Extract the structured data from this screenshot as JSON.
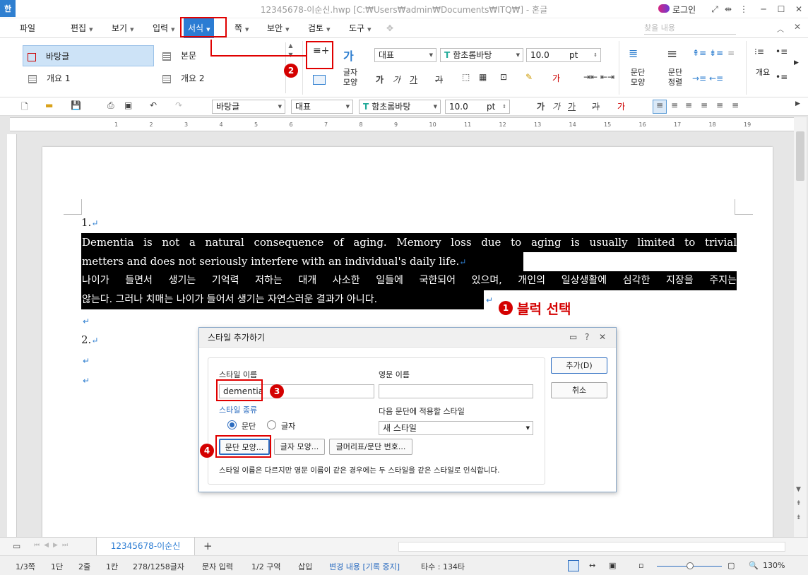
{
  "window": {
    "app_icon": "한",
    "title": "12345678-이순신.hwp [C:₩Users₩admin₩Documents₩ITQ₩] - 혼글",
    "login": "로그인"
  },
  "menu": {
    "file": "파일",
    "items": [
      "편집",
      "보기",
      "입력",
      "서식",
      "쪽",
      "보안",
      "검토",
      "도구"
    ],
    "search_placeholder": "찾을 내용"
  },
  "ribbon": {
    "style_list": [
      "바탕글",
      "본문",
      "개요 1",
      "개요 2"
    ],
    "style_combo": "대표",
    "font_combo": "함초롬바탕",
    "size_combo": "10.0",
    "size_unit": "pt",
    "char_shape_label": "글자\n모양",
    "para_shape_label": "문단\n모양",
    "para_align_label": "문단\n정렬",
    "outline_label": "개요"
  },
  "toolbar": {
    "style_combo": "바탕글",
    "lang_combo": "대표",
    "font_combo": "함초롬바탕",
    "size_combo": "10.0",
    "size_unit": "pt"
  },
  "ruler": {
    "ticks": [
      "1",
      "2",
      "3",
      "4",
      "5",
      "6",
      "7",
      "8",
      "9",
      "10",
      "11",
      "12",
      "13",
      "14",
      "15",
      "16",
      "17",
      "18",
      "19"
    ]
  },
  "document": {
    "item1": "1.",
    "item2": "2.",
    "para_line1": "Dementia is not a natural consequence of aging. Memory loss due to aging is usually limited to trivial",
    "para_line2": "metters and does not seriously interfere with an individual's daily life.",
    "para_line3": "나이가 들면서 생기는 기억력 저하는 대개 사소한 일들에 국한되어 있으며, 개인의 일상생활에 심각한 지장을 주지는",
    "para_line4": "않는다. 그러나 치매는 나이가 들어서 생기는 자연스러운 결과가 아니다.",
    "return_mark": "↵"
  },
  "annotations": {
    "step1_label": "블럭 선택",
    "badges": [
      "1",
      "2",
      "3",
      "4"
    ]
  },
  "dialog": {
    "title": "스타일 추가하기",
    "style_name_label": "스타일 이름",
    "style_name_value": "dementia",
    "english_name_label": "영문 이름",
    "english_name_value": "",
    "style_type_label": "스타일 종류",
    "radio_paragraph": "문단",
    "radio_char": "글자",
    "next_style_label": "다음 문단에 적용할 스타일",
    "next_style_value": "새 스타일",
    "btn_para_shape": "문단 모양...",
    "btn_char_shape": "글자 모양...",
    "btn_bullet": "글머리표/문단 번호...",
    "note": "스타일 이름은 다르지만 영문 이름이 같은 경우에는 두 스타일을 같은 스타일로 인식합니다.",
    "add_button": "추가(D)",
    "cancel_button": "취소"
  },
  "tabs": {
    "doc_tab": "12345678-이순신",
    "add": "+"
  },
  "status": {
    "page": "1/3쪽",
    "column": "1단",
    "line": "2줄",
    "cell": "1칸",
    "chars": "278/1258글자",
    "input_mode": "문자 입력",
    "section": "1/2 구역",
    "insert": "삽입",
    "track": "변경 내용 [기록 중지]",
    "typing": "타수 : 134타",
    "zoom": "130%"
  },
  "colors": {
    "accent": "#2b7cd3",
    "annotation_red": "#e00000"
  }
}
